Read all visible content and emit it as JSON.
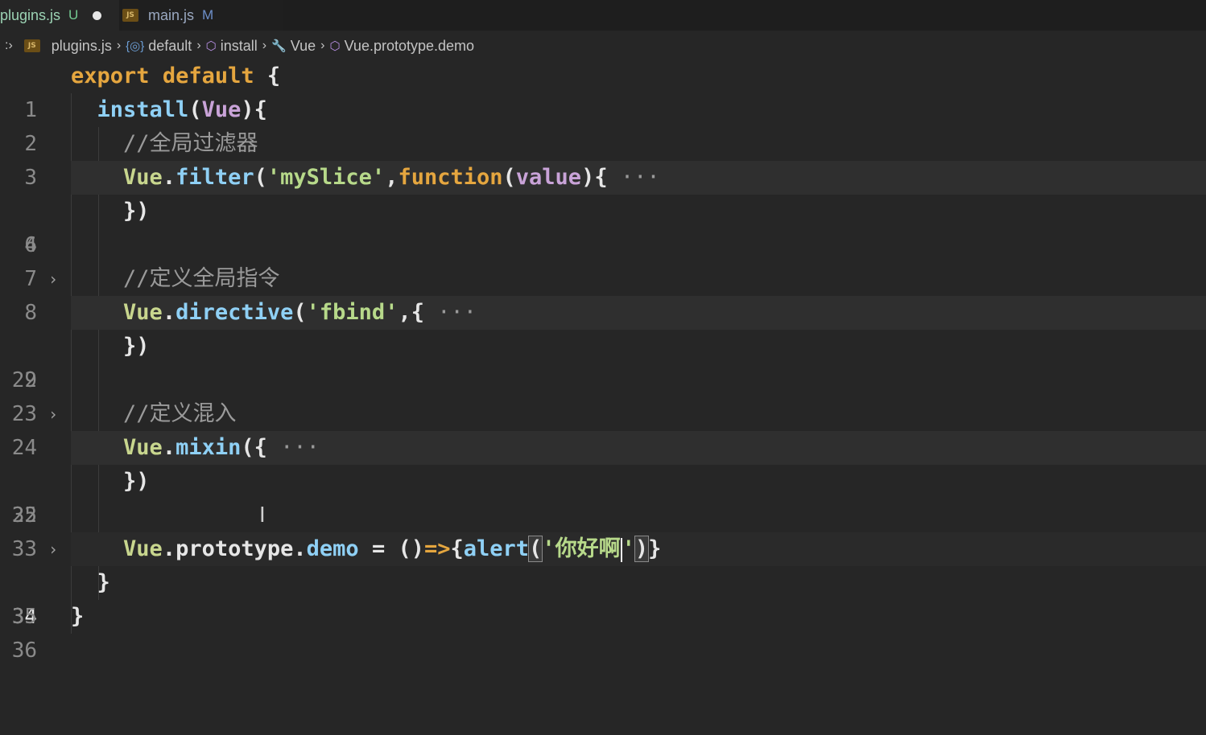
{
  "tabs": [
    {
      "label": "plugins.js",
      "badge": "U",
      "dirty": true
    },
    {
      "label": "main.js",
      "badge": "M"
    }
  ],
  "breadcrumb": [
    {
      "label": "plugins.js",
      "icon": "js-file-icon"
    },
    {
      "label": "default",
      "icon": "module-icon"
    },
    {
      "label": "install",
      "icon": "method-cube-icon"
    },
    {
      "label": "Vue",
      "icon": "wrench-icon"
    },
    {
      "label": "Vue.prototype.demo",
      "icon": "method-cube-icon"
    }
  ],
  "editor": {
    "lines": [
      {
        "num": "1"
      },
      {
        "num": "2"
      },
      {
        "num": "3",
        "comment": "//全局过滤器"
      },
      {
        "num": "4",
        "folded": true
      },
      {
        "num": "6"
      },
      {
        "num": "7"
      },
      {
        "num": "8",
        "comment": "//定义全局指令"
      },
      {
        "num": "9",
        "folded": true
      },
      {
        "num": "22"
      },
      {
        "num": "23"
      },
      {
        "num": "24",
        "comment": "//定义混入"
      },
      {
        "num": "25",
        "folded": true
      },
      {
        "num": "32"
      },
      {
        "num": "33"
      },
      {
        "num": "34",
        "current": true
      },
      {
        "num": "35"
      },
      {
        "num": "36"
      }
    ],
    "tokens": {
      "export": "export",
      "default": "default",
      "install": "install",
      "vue": "Vue",
      "filter": "filter",
      "myslice": "'mySlice'",
      "function": "function",
      "value": "value",
      "directive": "directive",
      "fbind": "'fbind'",
      "mixin": "mixin",
      "prototype": "prototype",
      "demo": "demo",
      "alert": "alert",
      "string_open": "'你好啊",
      "string_close": "'",
      "ellipsis": "···"
    }
  },
  "colors": {
    "keyword": "#e5a63f",
    "function": "#8fd0f5",
    "object": "#c8d68e",
    "param": "#c9a3d8",
    "string": "#b7d98a",
    "comment": "#9a9a9a"
  }
}
